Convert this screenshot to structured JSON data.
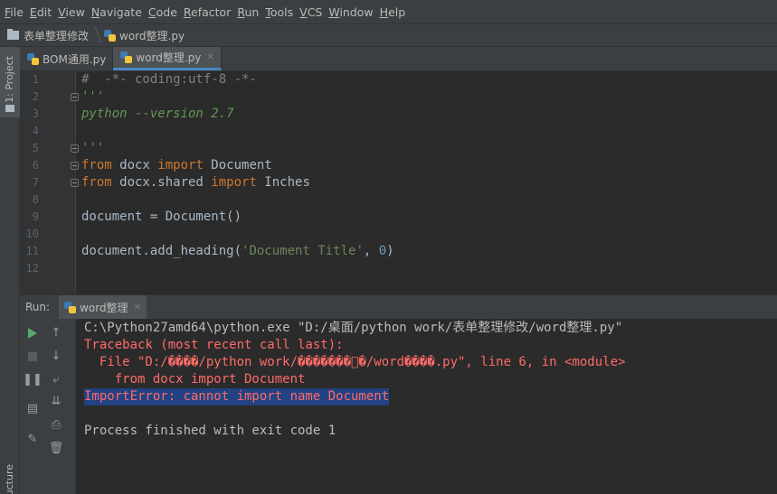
{
  "menu": [
    "File",
    "Edit",
    "View",
    "Navigate",
    "Code",
    "Refactor",
    "Run",
    "Tools",
    "VCS",
    "Window",
    "Help"
  ],
  "breadcrumb": {
    "folder": "表单整理修改",
    "file": "word整理.py"
  },
  "side_panel": {
    "project": "1: Project",
    "structure": "ucture"
  },
  "editor_tabs": [
    {
      "label": "BOM通用.py",
      "active": false
    },
    {
      "label": "word整理.py",
      "active": true
    }
  ],
  "editor": {
    "line_numbers": [
      "1",
      "2",
      "3",
      "4",
      "5",
      "6",
      "7",
      "8",
      "9",
      "10",
      "11",
      "12"
    ],
    "lines": [
      [
        {
          "t": "#  -*- coding:utf-8 -*-",
          "c": "comment"
        }
      ],
      [
        {
          "t": "'''",
          "c": "doc"
        }
      ],
      [
        {
          "t": "python --version 2.7",
          "c": "doc"
        }
      ],
      [
        {
          "t": "",
          "c": "plain"
        }
      ],
      [
        {
          "t": "'''",
          "c": "doc"
        }
      ],
      [
        {
          "t": "from",
          "c": "kw"
        },
        {
          "t": " docx ",
          "c": "plain"
        },
        {
          "t": "import",
          "c": "kw"
        },
        {
          "t": " Document",
          "c": "plain"
        }
      ],
      [
        {
          "t": "from",
          "c": "kw"
        },
        {
          "t": " docx.shared ",
          "c": "plain"
        },
        {
          "t": "import",
          "c": "kw"
        },
        {
          "t": " Inches",
          "c": "plain"
        }
      ],
      [
        {
          "t": "",
          "c": "plain"
        }
      ],
      [
        {
          "t": "document = Document()",
          "c": "plain"
        }
      ],
      [
        {
          "t": "",
          "c": "plain"
        }
      ],
      [
        {
          "t": "document.add_heading(",
          "c": "plain"
        },
        {
          "t": "'Document Title'",
          "c": "str"
        },
        {
          "t": ", ",
          "c": "plain"
        },
        {
          "t": "0",
          "c": "num"
        },
        {
          "t": ")",
          "c": "plain"
        }
      ],
      [
        {
          "t": "",
          "c": "plain"
        }
      ]
    ]
  },
  "run_panel": {
    "label": "Run:",
    "tab": "word整理",
    "console": [
      {
        "t": "C:\\Python27amd64\\python.exe \"D:/桌面/python work/表单整理修改/word整理.py\"",
        "c": "normal"
      },
      {
        "t": "Traceback (most recent call last):",
        "c": "error"
      },
      {
        "t": "  File \"D:/����/python work/�������\u0000�/word����.py\", line 6, in <module>",
        "c": "error"
      },
      {
        "t": "    from docx import Document",
        "c": "error"
      },
      {
        "t": "ImportError: cannot import name Document",
        "c": "selected"
      },
      {
        "t": "",
        "c": "normal"
      },
      {
        "t": "Process finished with exit code 1",
        "c": "normal"
      }
    ]
  },
  "colors": {
    "accent": "#4a88c7",
    "error": "#ff6b68",
    "run_green": "#59a869",
    "selection": "#214283"
  },
  "icons": [
    "folder-icon",
    "python-file-icon",
    "close-icon",
    "run-icon",
    "stop-icon",
    "pause-icon",
    "up-arrow-icon",
    "down-arrow-icon",
    "soft-wrap-icon",
    "scroll-to-end-icon",
    "layout-icon",
    "print-icon",
    "pin-icon",
    "trash-icon"
  ]
}
